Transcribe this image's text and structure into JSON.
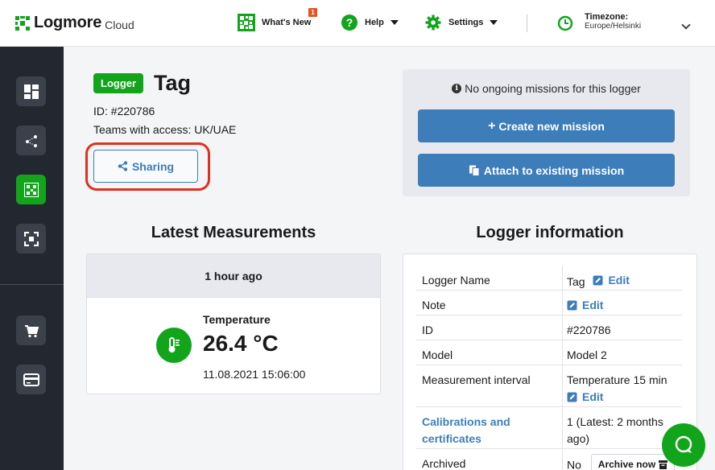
{
  "brand": {
    "name": "Logmore",
    "sub": "Cloud"
  },
  "nav": {
    "whats_new": "What's New",
    "whats_new_badge": "1",
    "help": "Help",
    "settings": "Settings",
    "timezone_label": "Timezone:",
    "timezone_value": "Europe/Helsinki"
  },
  "sidebar": {
    "items": [
      {
        "icon": "dashboard-icon"
      },
      {
        "icon": "share-network-icon"
      },
      {
        "icon": "logger-qr-icon",
        "active": true
      },
      {
        "icon": "scan-icon"
      },
      {
        "icon": "cart-icon"
      },
      {
        "icon": "credit-card-icon"
      }
    ]
  },
  "logger": {
    "type_badge": "Logger",
    "name": "Tag",
    "id_line": "ID: #220786",
    "teams_line": "Teams with access: UK/UAE",
    "sharing_label": "Sharing"
  },
  "missions": {
    "message": "No ongoing missions for this logger",
    "create_label": "Create new mission",
    "attach_label": "Attach to existing mission"
  },
  "latest": {
    "heading": "Latest Measurements",
    "ago": "1 hour ago",
    "label": "Temperature",
    "value": "26.4 °C",
    "timestamp": "11.08.2021 15:06:00"
  },
  "info": {
    "heading": "Logger information",
    "edit_label": "Edit",
    "rows": [
      {
        "key": "Logger Name",
        "value": "Tag"
      },
      {
        "key": "Note",
        "value": ""
      },
      {
        "key": "ID",
        "value": "#220786"
      },
      {
        "key": "Model",
        "value": "Model 2"
      },
      {
        "key": "Measurement interval",
        "value": "Temperature 15 min"
      },
      {
        "key": "Calibrations and certificates",
        "value": "1 (Latest: 2 months ago)"
      },
      {
        "key": "Archived",
        "value": "No"
      }
    ],
    "archive_label": "Archive now"
  },
  "colors": {
    "brand_green": "#12a51c",
    "link_blue": "#3d7dba",
    "highlight_red": "#e0301e",
    "sidebar_bg": "#232830"
  }
}
